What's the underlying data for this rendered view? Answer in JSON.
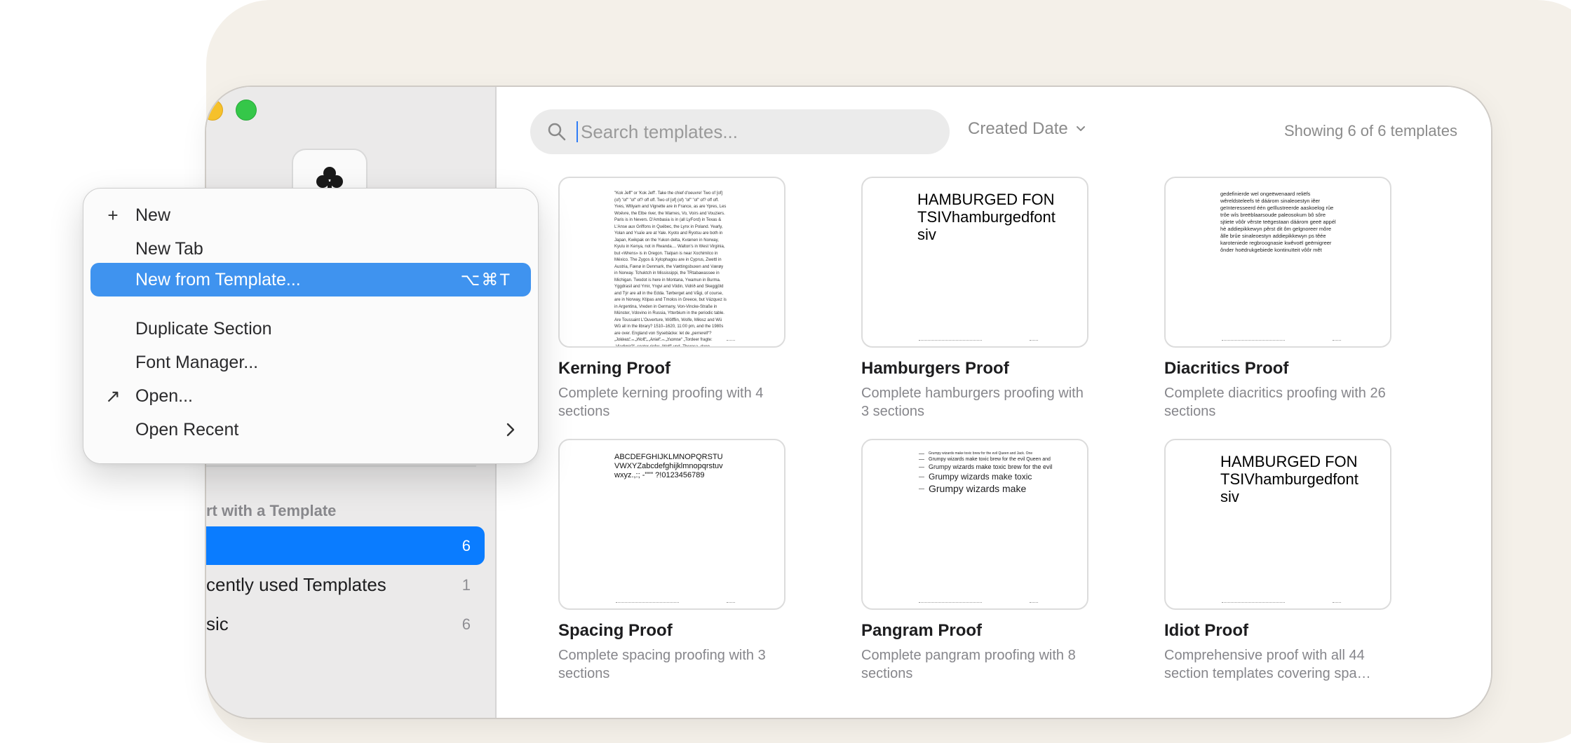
{
  "sidebar": {
    "section_header": "rt with a Template",
    "items": [
      {
        "label": "",
        "count": "6"
      },
      {
        "label": "cently used Templates",
        "count": "1"
      },
      {
        "label": "sic",
        "count": "6"
      }
    ]
  },
  "search": {
    "placeholder": "Search templates...",
    "value": ""
  },
  "sort": {
    "label": "Created Date"
  },
  "status": {
    "count_text": "Showing 6 of 6 templates"
  },
  "templates": [
    {
      "title": "Kerning Proof",
      "description": "Complete kerning proofing with 4 sections",
      "preview": "\"Kok Jeff\" or 'Kok Jeff'. Take the chief d'oeuvre! Two of [of] (of) \"of\" \"of\" of? off off. Two of [of] (of) \"of\" \"of\" of? off off. Yves, Wlliyam and Vignette are in France, as are Ypres, Les Woëvre, the Elbe river, the Warnes, Vo, Voirs and Vouziers. Paris is in Nevers. D'Ambasia is in (all LyFord) in Texas & L'Anse aux Griffons in Québec, the Lynx in Poland. Yearly, Yolan and Ysaïe are at Yale. Kyoto and Ryotsu are both in Japan, Kwikpak on the Yukon delta, Kvœnen in Norway, Kyulu in Kenya, not in Rwanda.... Walton's in West Virginia, but «Wrens» is in Oregon. Tlalpan is near Xochimilco in México. The Zygos & Xylophagou are in Cyprus, Zwettl in Austria, Fænø in Denmark, the Vættingsbuxen and Værøy in Norway. Tchuktch in Mississippi, the TRtabawassee in Michigan. Twodot is here in Montana, Ywamun in Burma. Yggdrasil and Ymir, Yngvi and Vödin, Vidrið and Skeggjöld and Týr are all in the Edda. Tørberget and Vågi, of course, are in Norway, Ktipas and Tmolos in Greece, but Vázquez is in Argentina, Vreden in Germany, Von-Vincke-Straße in Münster, Vdovino in Russia, Ytterbium in the periodic table. Are Toussaint L'Ouverture, Wölfflin, Wolfe, Miłosz and Wü Wŭ all in the library? 1510–1620, 11:00 pm, and the 1980s are over. England von Sysebäcke: let de „perrerell“? „Jokken“ – „Wolf“, „Aniel“ – „Yvonne“ „Tordeer fragte: „Vladimir?“, spater riefer „Wolf“ und „Theresa, dann „Andreas“ und „Yvonne“ Ellegerher: „Vel da „Antrando“? «Volker?» – «Wolf», «Anna?» – «Yvonne»"
    },
    {
      "title": "Hamburgers Proof",
      "description": "Complete hamburgers proofing with 3 sections",
      "preview": "HAMBURGED FONTSIVhamburgedfontsiv"
    },
    {
      "title": "Diacritics Proof",
      "description": "Complete diacritics proofing with 26 sections",
      "preview": "gedefinierde wel ongeëwenaard reliëfs wêreldsteleefs té dáárom sinaleoestyn iêer geïnteresseerd één geïllustreerde aaskoelog rûe trôe wîs breëblaarsoude paleosokum bô sôre sjtiete vôôr vêrste teëgestaan dáárom geeë appél hè addiepikkewyn pêrst dit ôm gelgnoreer môre âlle brûe sinaleoestyn addiepikkewyn ps têée karoteniede regbroognasie kwêvoël geëmigreer ônder hoëdrukgebiede kontinuïteit vôôr mêt"
    },
    {
      "title": "Spacing Proof",
      "description": "Complete spacing proofing with 3 sections",
      "preview": "ABCDEFGHIJKLMNOPQRSTUVWXYZabcdefghijklmnopqrstuvwxyz.,:; -\"\"\" ?!0123456789"
    },
    {
      "title": "Pangram Proof",
      "description": "Complete pangram proofing with 8 sections",
      "preview_lines": [
        "Grumpy wizards make toxic brew for the evil Queen and Jack. One",
        "Grumpy wizards make toxic brew for the evil Queen and",
        "Grumpy wizards make toxic brew for the evil",
        "Grumpy wizards make toxic",
        "Grumpy wizards make"
      ]
    },
    {
      "title": "Idiot Proof",
      "description": "Comprehensive proof with all 44 section templates covering spa…",
      "preview": "HAMBURGED FONTSIVhamburgedfontsiv"
    }
  ],
  "menu": {
    "items": [
      {
        "label": "New",
        "icon": "plus-icon",
        "glyph": "+"
      },
      {
        "label": "New Tab"
      },
      {
        "label": "New from Template...",
        "shortcut": "⌥⌘T",
        "highlighted": true
      },
      {
        "label": "Duplicate Section"
      },
      {
        "label": "Font Manager..."
      },
      {
        "label": "Open...",
        "icon": "arrow-up-right-icon",
        "glyph": "↗"
      },
      {
        "label": "Open Recent",
        "icon_right": "chevron-right-icon"
      }
    ]
  },
  "colors": {
    "accent": "#0a7cff",
    "menu_highlight": "#3f93ef",
    "backdrop": "#f4f0e9",
    "sidebar_bg": "#ebeaea",
    "traffic_yellow": "#f6c12b",
    "traffic_green": "#35c749"
  }
}
